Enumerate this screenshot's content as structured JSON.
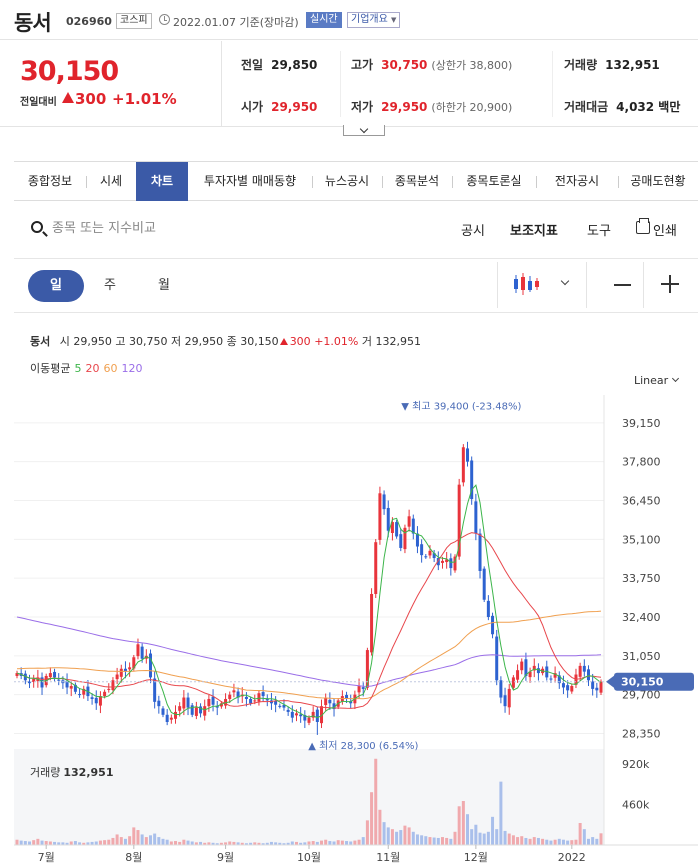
{
  "header": {
    "name": "동서",
    "code": "026960",
    "market": "코스피",
    "date": "2022.01.07 기준(장마감)",
    "realtime": "실시간",
    "profile": "기업개요"
  },
  "price": {
    "current": "30,150",
    "change_label": "전일대비",
    "change": "300",
    "change_pct": "+1.01%",
    "prev_label": "전일",
    "prev": "29,850",
    "open_label": "시가",
    "open": "29,950",
    "high_label": "고가",
    "high": "30,750",
    "upper": "(상한가 38,800)",
    "low_label": "저가",
    "low": "29,950",
    "lower": "(하한가 20,900)",
    "volume_label": "거래량",
    "volume": "132,951",
    "amount_label": "거래대금",
    "amount": "4,032 백만"
  },
  "tabs": [
    {
      "label": "종합정보"
    },
    {
      "label": "시세"
    },
    {
      "label": "차트"
    },
    {
      "label": "투자자별 매매동향"
    },
    {
      "label": "뉴스공시"
    },
    {
      "label": "종목분석"
    },
    {
      "label": "종목토론실"
    },
    {
      "label": "전자공시"
    },
    {
      "label": "공매도현황"
    }
  ],
  "active_tab": 2,
  "search": {
    "placeholder": "종목 또는 지수비교"
  },
  "tools": {
    "notice": "공시",
    "indicator": "보조지표",
    "tool": "도구",
    "print": "인쇄"
  },
  "periods": [
    {
      "label": "일"
    },
    {
      "label": "주"
    },
    {
      "label": "월"
    }
  ],
  "active_period": 0,
  "info": {
    "name": "동서",
    "open": "시 29,950",
    "high": "고 30,750",
    "low": "저 29,950",
    "close": "종 30,150",
    "change": "300",
    "change_pct": "+1.01%",
    "volume": "거 132,951"
  },
  "ma_legend": {
    "label": "이동평균",
    "items": [
      {
        "label": "5",
        "color": "#3cb54a"
      },
      {
        "label": "20",
        "color": "#e8474c"
      },
      {
        "label": "60",
        "color": "#f0a050"
      },
      {
        "label": "120",
        "color": "#9a6ee8"
      }
    ]
  },
  "scale_mode": "Linear",
  "volume_label": "거래량",
  "volume_value": "132,951",
  "colors": {
    "up": "#e8343c",
    "down": "#2d62d0",
    "accent": "#3b5aa7",
    "current_tag": "#4a6bb6"
  },
  "chart_data": {
    "type": "candlestick",
    "y_ticks": [
      "39,150",
      "37,800",
      "36,450",
      "35,100",
      "33,750",
      "32,400",
      "31,050",
      "29,700",
      "28,350"
    ],
    "y_tick_values": [
      39150,
      37800,
      36450,
      35100,
      33750,
      32400,
      31050,
      29700,
      28350
    ],
    "volume_ticks": [
      "920k",
      "460k"
    ],
    "volume_tick_values": [
      920000,
      460000
    ],
    "x_ticks": [
      {
        "label": "7월",
        "index": 7
      },
      {
        "label": "8월",
        "index": 28
      },
      {
        "label": "9월",
        "index": 50
      },
      {
        "label": "10월",
        "index": 70
      },
      {
        "label": "11월",
        "index": 89
      },
      {
        "label": "12월",
        "index": 110
      },
      {
        "label": "2022",
        "index": 133
      }
    ],
    "max_label": "최고 39,400 (-23.48%)",
    "max_value": 39400,
    "max_index": 107,
    "min_label": "최저 28,300 (6.54%)",
    "min_value": 28300,
    "min_index": 72,
    "current_tag": "30,150",
    "current_value": 30150,
    "closes": [
      30450,
      30350,
      30200,
      30100,
      30250,
      30300,
      29950,
      30350,
      30450,
      30300,
      30200,
      30100,
      29950,
      30000,
      29800,
      29700,
      29900,
      29650,
      29550,
      29400,
      29650,
      29800,
      29900,
      30200,
      30400,
      30600,
      30500,
      30650,
      31000,
      31450,
      30950,
      31050,
      30300,
      29450,
      29300,
      29000,
      28750,
      28900,
      29100,
      29300,
      29600,
      29250,
      29000,
      29250,
      29050,
      29300,
      29550,
      29350,
      29250,
      29400,
      29550,
      29700,
      29850,
      29600,
      29700,
      29550,
      29400,
      29500,
      29750,
      29650,
      29500,
      29400,
      29350,
      29300,
      29250,
      29100,
      28900,
      29050,
      28950,
      28800,
      28900,
      29100,
      28750,
      29300,
      29600,
      29400,
      29200,
      29500,
      29650,
      29550,
      29400,
      29700,
      30000,
      29900,
      31250,
      33200,
      35000,
      36700,
      36150,
      35400,
      35700,
      35200,
      34800,
      35500,
      35900,
      35300,
      34850,
      34550,
      34500,
      34700,
      34450,
      34200,
      34350,
      34400,
      34100,
      34500,
      37000,
      38300,
      37800,
      36500,
      35300,
      34000,
      33000,
      32400,
      31800,
      30200,
      29600,
      29300,
      29900,
      30300,
      30550,
      30850,
      30350,
      30500,
      30700,
      30450,
      30600,
      30300,
      30250,
      30450,
      30100,
      29950,
      29850,
      30000,
      30400,
      30700,
      30500,
      30200,
      29900,
      29850,
      30150
    ],
    "ma120_start": 32400,
    "ma120_end": 30800,
    "ma60_start": 30600,
    "ma60_end": 32200,
    "volumes": [
      60000,
      50000,
      45000,
      40000,
      55000,
      70000,
      50000,
      45000,
      40000,
      35000,
      30000,
      30000,
      25000,
      40000,
      45000,
      30000,
      25000,
      30000,
      35000,
      40000,
      50000,
      55000,
      60000,
      80000,
      120000,
      90000,
      70000,
      100000,
      200000,
      170000,
      120000,
      90000,
      110000,
      130000,
      90000,
      70000,
      60000,
      40000,
      45000,
      35000,
      60000,
      50000,
      40000,
      30000,
      35000,
      25000,
      30000,
      25000,
      20000,
      25000,
      30000,
      40000,
      35000,
      30000,
      25000,
      20000,
      25000,
      30000,
      25000,
      20000,
      25000,
      35000,
      30000,
      25000,
      20000,
      25000,
      40000,
      35000,
      25000,
      30000,
      40000,
      45000,
      35000,
      50000,
      60000,
      45000,
      40000,
      55000,
      50000,
      45000,
      40000,
      50000,
      60000,
      90000,
      280000,
      600000,
      980000,
      400000,
      260000,
      200000,
      180000,
      150000,
      170000,
      220000,
      200000,
      150000,
      120000,
      110000,
      100000,
      90000,
      85000,
      80000,
      90000,
      80000,
      70000,
      150000,
      440000,
      500000,
      350000,
      180000,
      230000,
      140000,
      130000,
      150000,
      320000,
      180000,
      720000,
      160000,
      130000,
      110000,
      90000,
      100000,
      80000,
      70000,
      90000,
      80000,
      70000,
      60000,
      50000,
      60000,
      70000,
      60000,
      50000,
      55000,
      60000,
      250000,
      180000,
      70000,
      90000,
      70000,
      132951
    ]
  }
}
